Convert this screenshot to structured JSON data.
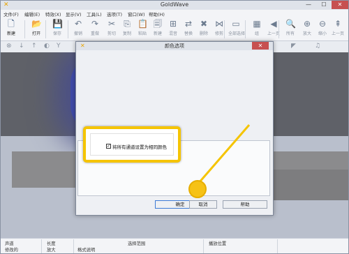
{
  "window": {
    "title": "GoldWave",
    "min": "—",
    "max": "☐",
    "close": "✕"
  },
  "menu": [
    "文件(F)",
    "编辑(E)",
    "特效(X)",
    "显示(V)",
    "工具(L)",
    "选项(T)",
    "窗口(W)",
    "帮助(H)"
  ],
  "toolbar": {
    "tools": [
      {
        "name": "new",
        "label": "新建",
        "icon": "file-icon",
        "glyph": "🗋",
        "active": true
      },
      {
        "name": "open",
        "label": "打开",
        "icon": "folder-icon",
        "glyph": "📂",
        "active": true
      },
      {
        "name": "save",
        "label": "保存",
        "icon": "save-icon",
        "glyph": "💾",
        "active": false
      },
      {
        "name": "undo",
        "label": "撤销",
        "icon": "undo-icon",
        "glyph": "↶",
        "active": false
      },
      {
        "name": "redo",
        "label": "重做",
        "icon": "redo-icon",
        "glyph": "↷",
        "active": false
      },
      {
        "name": "cut",
        "label": "剪切",
        "icon": "scissors-icon",
        "glyph": "✂",
        "active": false
      },
      {
        "name": "copy",
        "label": "复制",
        "icon": "copy-icon",
        "glyph": "⎘",
        "active": false
      },
      {
        "name": "paste",
        "label": "粘贴",
        "icon": "paste-icon",
        "glyph": "📋",
        "active": false
      },
      {
        "name": "paste-new",
        "label": "新建",
        "icon": "paste-new-icon",
        "glyph": "🗐",
        "active": false
      },
      {
        "name": "mix",
        "label": "混音",
        "icon": "mix-icon",
        "glyph": "⊞",
        "active": false
      },
      {
        "name": "replace",
        "label": "替换",
        "icon": "replace-icon",
        "glyph": "⇄",
        "active": false
      },
      {
        "name": "delete",
        "label": "删除",
        "icon": "delete-icon",
        "glyph": "✖",
        "active": false
      },
      {
        "name": "trim",
        "label": "修剪",
        "icon": "trim-icon",
        "glyph": "⋈",
        "active": false
      },
      {
        "name": "select-all",
        "label": "全部选择",
        "icon": "select-all-icon",
        "glyph": "▭",
        "active": false
      },
      {
        "name": "set",
        "label": "组",
        "icon": "set-icon",
        "glyph": "▦",
        "active": false
      },
      {
        "name": "prev",
        "label": "上一页",
        "icon": "prev-icon",
        "glyph": "◀",
        "active": false
      },
      {
        "name": "all",
        "label": "所有",
        "icon": "all-icon",
        "glyph": "🔍",
        "active": false
      },
      {
        "name": "zoom-in",
        "label": "放大",
        "icon": "zoom-in-icon",
        "glyph": "⊕",
        "active": false
      },
      {
        "name": "zoom-out",
        "label": "缩小",
        "icon": "zoom-out-icon",
        "glyph": "⊖",
        "active": false
      },
      {
        "name": "up",
        "label": "上一页",
        "icon": "up-icon",
        "glyph": "⇞",
        "active": false
      }
    ]
  },
  "toolbar2": {
    "glyphs": [
      "⊗",
      "↓",
      "↑",
      "◐",
      "Y",
      "⌁",
      "≈",
      "▲",
      "◢",
      "♪",
      "◥",
      "◣",
      "◤",
      "♫"
    ]
  },
  "dialog": {
    "title": "颜色选项",
    "close": "✕",
    "checkbox_label": "将所有通道设置为相同颜色",
    "checkbox_mark": "✓",
    "ok": "确定",
    "cancel": "取消",
    "help": "帮助"
  },
  "status": {
    "channel_label": "声道",
    "length_label": "长度",
    "selection_label": "选择范围",
    "playpos_label": "播放位置",
    "modified": "修改的",
    "zoom": "放大",
    "format": "格式说明"
  },
  "colors": {
    "accent": "#f5c400",
    "close_red": "#c75050"
  }
}
